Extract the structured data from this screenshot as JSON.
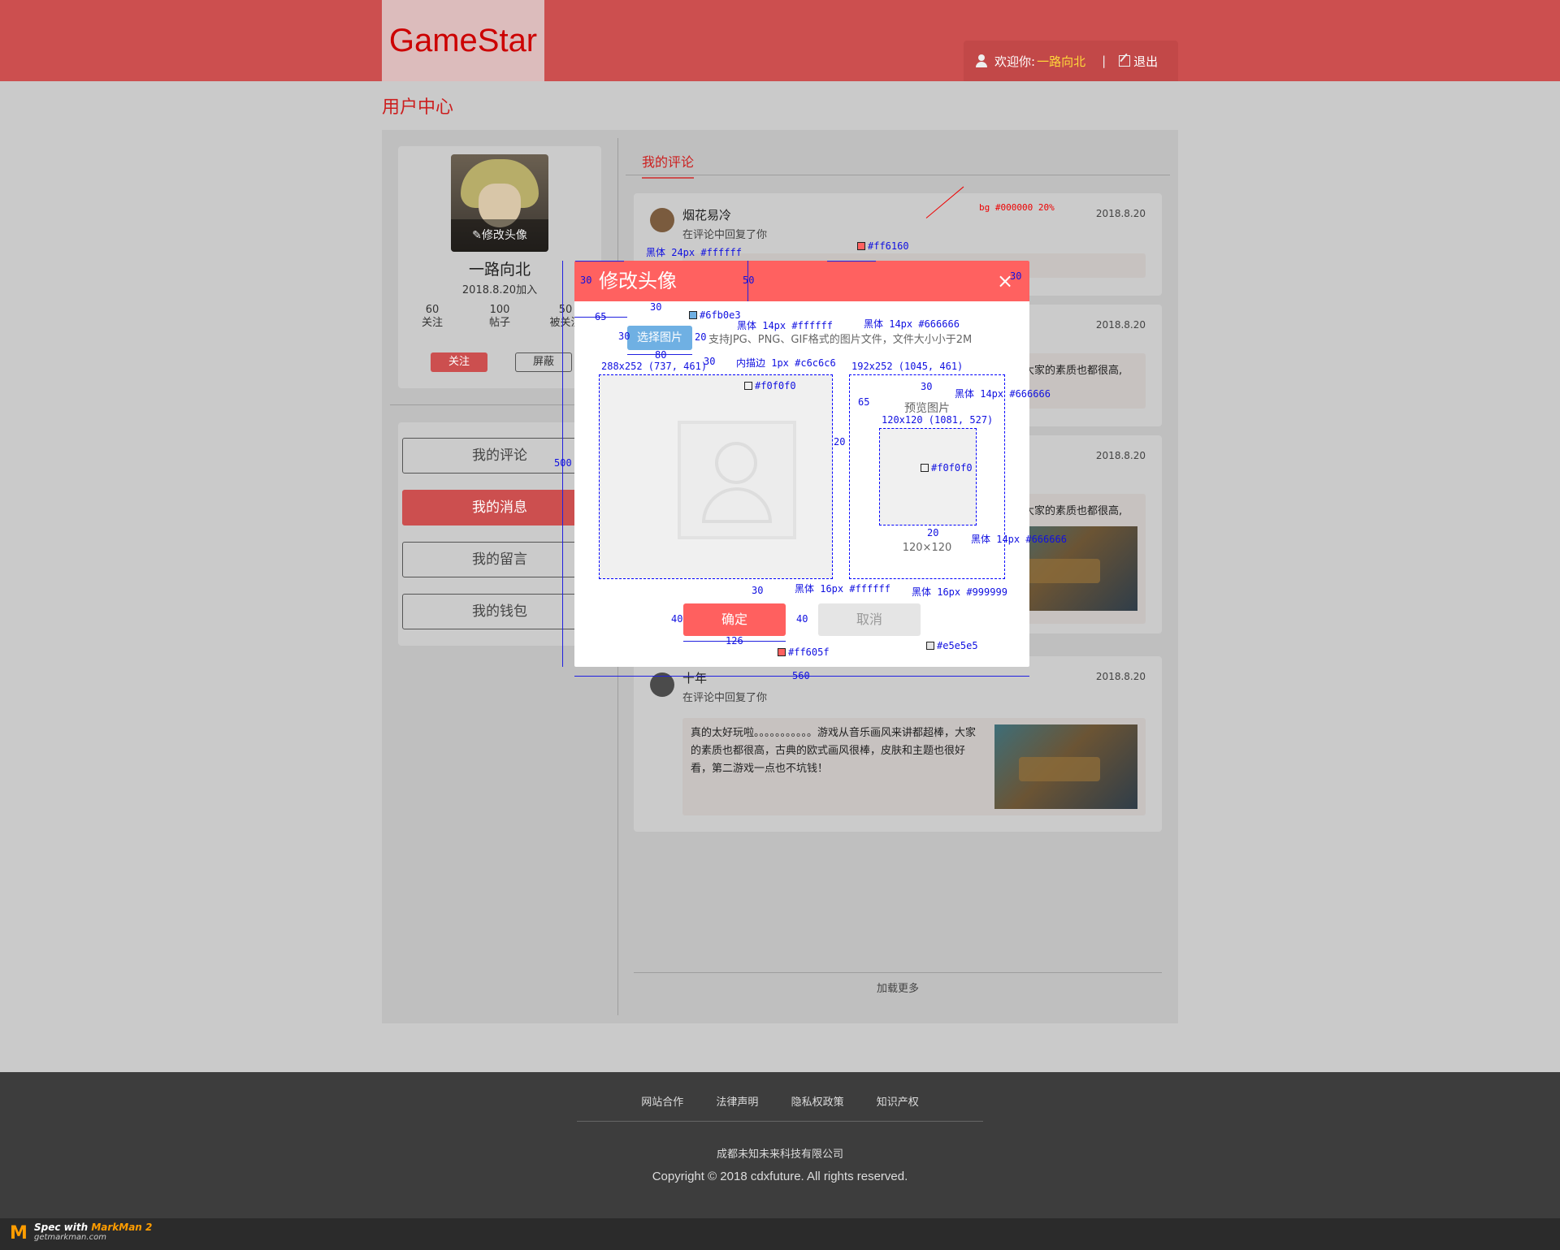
{
  "header": {
    "logo": "GameStar",
    "welcome": "欢迎你:",
    "username": "一路向北",
    "separator": "|",
    "logout": "退出"
  },
  "page_title": "用户中心",
  "profile": {
    "edit_avatar": "修改头像",
    "name": "一路向北",
    "joined": "2018.8.20加入",
    "stats": [
      {
        "value": "60",
        "label": "关注"
      },
      {
        "value": "100",
        "label": "帖子"
      },
      {
        "value": "50",
        "label": "被关注"
      }
    ],
    "follow": "关注",
    "block": "屏蔽"
  },
  "menu": [
    "我的评论",
    "我的消息",
    "我的留言",
    "我的钱包"
  ],
  "tab": "我的评论",
  "comments": [
    {
      "name": "烟花易冷",
      "sub": "在评论中回复了你",
      "date": "2018.8.20"
    },
    {
      "date": "2018.8.20",
      "peek": "大家的素质也都很高,"
    },
    {
      "date": "2018.8.20",
      "peek": "大家的素质也都很高,"
    },
    {
      "name": "十年",
      "sub": "在评论中回复了你",
      "date": "2018.8.20",
      "text": "真的太好玩啦。。。。。。。。。。。游戏从音乐画风来讲都超棒，大家的素质也都很高，古典的欧式画风很棒，皮肤和主题也很好看，第二游戏一点也不坑钱！"
    }
  ],
  "load_more": "加载更多",
  "footer": {
    "links": [
      "网站合作",
      "法律声明",
      "隐私权政策",
      "知识产权"
    ],
    "company": "成都未知未来科技有限公司",
    "copyright": "Copyright © 2018 cdxfuture. All rights reserved."
  },
  "markman": {
    "spec": "Spec with ",
    "name": "MarkMan 2",
    "site": "getmarkman.com"
  },
  "modal": {
    "title": "修改头像",
    "close": "×",
    "choose": "选择图片",
    "hint": "支持JPG、PNG、GIF格式的图片文件，文件大小小于2M",
    "preview_label": "预览图片",
    "preview_size": "120×120",
    "confirm": "确定",
    "cancel": "取消"
  },
  "annotations": {
    "bg": "bg #000000  20%",
    "title_font": "黑体 24px #ffffff",
    "header_color": "#ff6160",
    "choose_color": "#6fb0e3",
    "choose_font": "黑体 14px #ffffff",
    "hint_font": "黑体 14px #666666",
    "crop_size": "288x252 (737, 461)",
    "crop_border": "内描边 1px  #c6c6c6",
    "crop_bg": "#f0f0f0",
    "preview_size": "192x252 (1045, 461)",
    "preview_font": "黑体 14px #666666",
    "preview_img_size": "120x120 (1081, 527)",
    "preview_bg": "#f0f0f0",
    "size_font": "黑体 14px #666666",
    "ok_font": "黑体  16px #ffffff",
    "cancel_font": "黑体 16px #999999",
    "ok_color": "#ff605f",
    "cancel_color": "#e5e5e5",
    "d30a": "30",
    "d50": "50",
    "d30b": "30",
    "d65": "65",
    "d30c": "30",
    "d80": "80",
    "d20a": "20",
    "d30d": "30",
    "d500": "500",
    "d20b": "20",
    "d30e": "30",
    "d65b": "65",
    "d20c": "20",
    "d30f": "30",
    "d40a": "40",
    "d40b": "40",
    "d126": "126",
    "d560": "560"
  },
  "colors": {
    "topbar": "#cc4f4f",
    "accent": "#cc1e1e",
    "modal_header": "#ff6160",
    "choose_button": "#6fb0e3",
    "confirm_button": "#ff605f",
    "cancel_button": "#e5e5e5",
    "footer": "#3d3d3d"
  }
}
